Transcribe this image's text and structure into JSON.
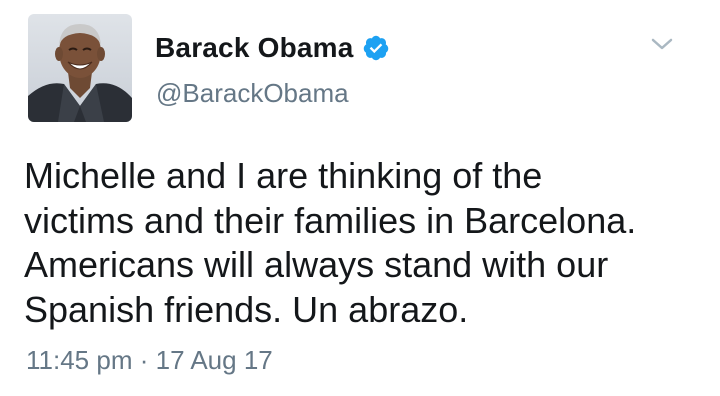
{
  "author": {
    "display_name": "Barack Obama",
    "handle": "@BarackObama",
    "verified": true,
    "avatar_icon": "profile-photo"
  },
  "tweet": {
    "text": "Michelle and I are thinking of the\nvictims and their families in Barcelona.\nAmericans will always stand with our\nSpanish friends. Un abrazo.",
    "time": "11:45 pm",
    "separator": "·",
    "date": "17 Aug 17"
  },
  "colors": {
    "name_text": "#14171a",
    "secondary_text": "#657786",
    "verified_blue": "#1da1f2",
    "background": "#ffffff"
  },
  "icons": {
    "verified": "verified-badge-icon",
    "menu": "chevron-down-icon"
  }
}
